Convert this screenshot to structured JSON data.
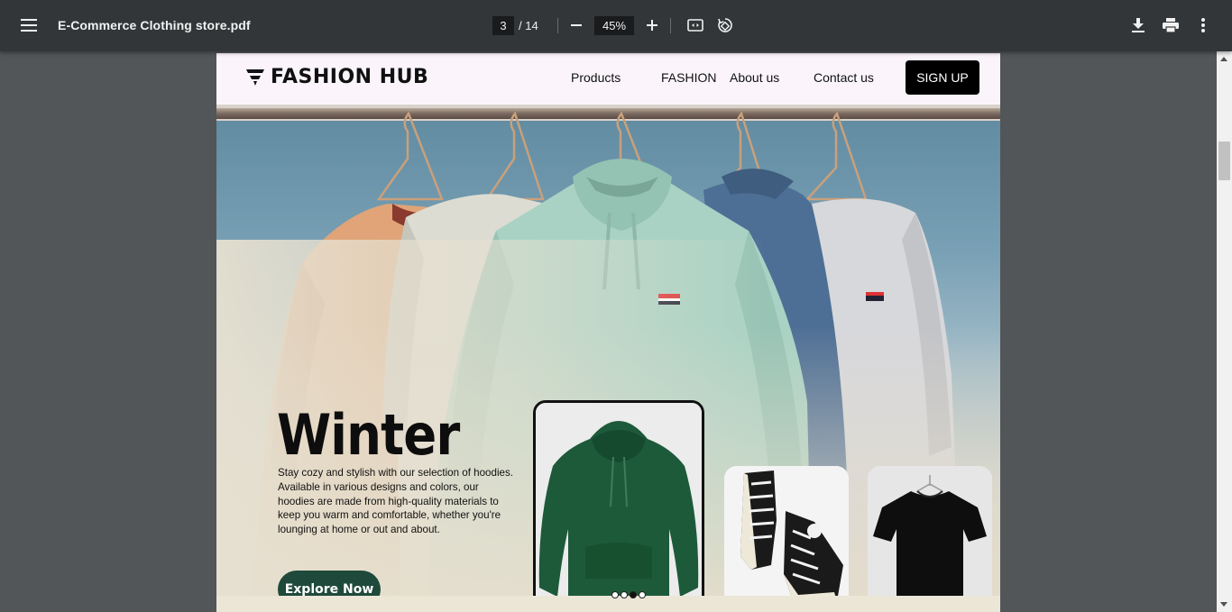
{
  "viewer": {
    "file_name": "E-Commerce Clothing store.pdf",
    "current_page": "3",
    "total_pages": "/ 14",
    "zoom": "45%"
  },
  "site": {
    "brand": "FASHION HUB",
    "nav": [
      "Products",
      "FASHION",
      "About us",
      "Contact us"
    ],
    "signup_label": "SIGN UP"
  },
  "hero": {
    "title": "Winter",
    "description": "Stay cozy and stylish with our selection of hoodies. Available in various designs and colors, our hoodies are made from high-quality materials to keep you warm and comfortable, whether you're lounging at home or out and about.",
    "cta_label": "Explore Now",
    "slides": 4,
    "active_slide": 3
  },
  "colors": {
    "toolbar": "#323639",
    "viewer_bg": "#525659",
    "cta": "#1f4a3b",
    "signup": "#000000"
  }
}
